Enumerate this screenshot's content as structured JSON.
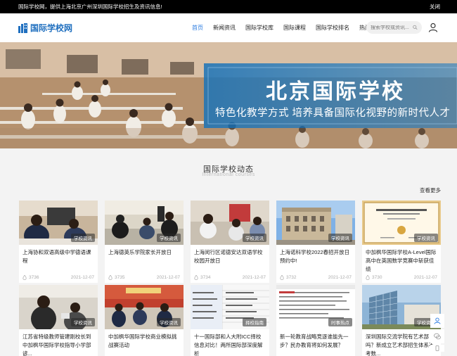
{
  "topbar": {
    "notice": "国际学校网，提供上海北京广州深圳国际学校招生及资讯信息!",
    "close_label": "关闭"
  },
  "header": {
    "logo_text": "国际学校网",
    "nav": [
      {
        "label": "首页",
        "active": true
      },
      {
        "label": "新闻资讯",
        "active": false
      },
      {
        "label": "国际学校库",
        "active": false
      },
      {
        "label": "国际课程",
        "active": false
      },
      {
        "label": "国际学校排名",
        "active": false
      },
      {
        "label": "热门专题",
        "active": false
      }
    ],
    "search_placeholder": "搜索学校或资讯..."
  },
  "banner": {
    "title": "北京国际学校",
    "subtitle": "特色化教学方式 培养具备国际化视野的新时代人才"
  },
  "section": {
    "title": "国际学校动态",
    "subtitle": "International courses",
    "more_label": "查看更多"
  },
  "cards_row1": [
    {
      "tag": "学校资讯",
      "title": "上海协和双语高级中学德语课程",
      "views": "3736",
      "date": "2021-12-07"
    },
    {
      "tag": "学校资讯",
      "title": "上海德英乐学院家长开放日",
      "views": "3735",
      "date": "2021-12-07"
    },
    {
      "tag": "学校资讯",
      "title": "上海闵行区诺德安达双语学校校园开放日",
      "views": "3734",
      "date": "2021-12-07"
    },
    {
      "tag": "学校资讯",
      "title": "上海诺科学校2022春招开放日预约中!",
      "views": "3732",
      "date": "2021-12-07"
    },
    {
      "tag": "学校资讯",
      "title": "中加枫华国际学校A-Level国际高中在英国数学竞赛中斩获佳绩",
      "views": "3730",
      "date": "2021-12-07"
    }
  ],
  "cards_row2": [
    {
      "tag": "学校资讯",
      "title": "江苏省特级教师管建刚校长到中加枫华国际学校指导小学部谚..."
    },
    {
      "tag": "学校资讯",
      "title": "中加枫华国际学校商业模拟挑战赛活动"
    },
    {
      "tag": "择校指南",
      "title": "十一国际部和人大附ICC择校信息对比！两所国际部深度解析"
    },
    {
      "tag": "时事热点",
      "title": "新一轮教育战略竞逐谁能先一步？民办教育将如何发展？"
    },
    {
      "tag": "学校资讯",
      "title": "深圳国际交流学院有艺术部吗？新成立艺术部招生体系不考数..."
    }
  ],
  "colors": {
    "accent": "#2a7be0",
    "logo": "#1f6fbf",
    "banner_overlay": "#1a73b8"
  }
}
